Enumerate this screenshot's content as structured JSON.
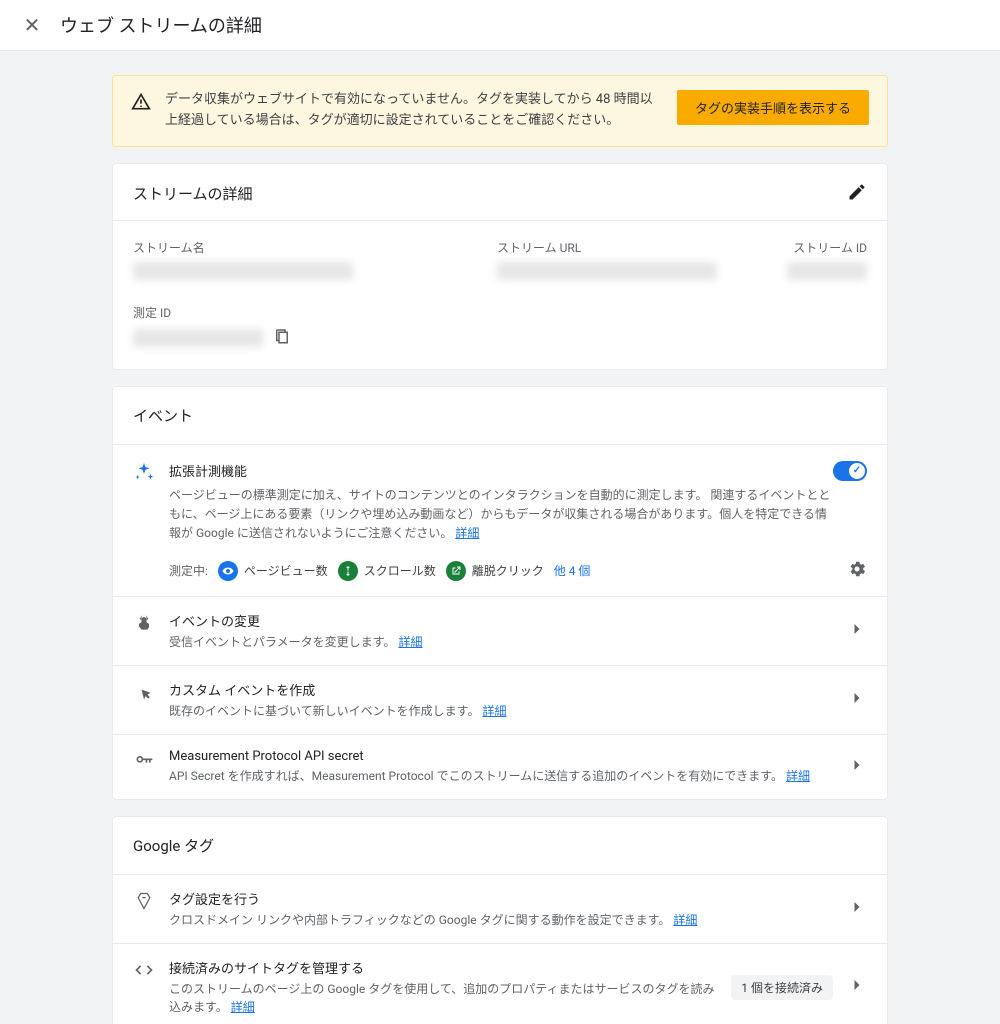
{
  "header": {
    "title": "ウェブ ストリームの詳細"
  },
  "alert": {
    "text": "データ収集がウェブサイトで有効になっていません。タグを実装してから 48 時間以上経過している場合は、タグが適切に設定されていることをご確認ください。",
    "button": "タグの実装手順を表示する"
  },
  "stream": {
    "title": "ストリームの詳細",
    "name_label": "ストリーム名",
    "url_label": "ストリーム URL",
    "id_label": "ストリーム ID",
    "measurement_id_label": "測定 ID"
  },
  "events": {
    "title": "イベント",
    "enhanced": {
      "title": "拡張計測機能",
      "desc": "ページビューの標準測定に加え、サイトのコンテンツとのインタラクションを自動的に測定します。\n関連するイベントとともに、ページ上にある要素（リンクや埋め込み動画など）からもデータが収集される場合があります。個人を特定できる情報が Google に送信されないようにご注意ください。",
      "details_link": "詳細",
      "measuring_label": "測定中:",
      "badge_pageview": "ページビュー数",
      "badge_scroll": "スクロール数",
      "badge_outbound": "離脱クリック",
      "more_count": "他 4 個"
    },
    "modify": {
      "title": "イベントの変更",
      "desc": "受信イベントとパラメータを変更します。",
      "link": "詳細"
    },
    "custom": {
      "title": "カスタム イベントを作成",
      "desc": "既存のイベントに基づいて新しいイベントを作成します。",
      "link": "詳細"
    },
    "mp_secret": {
      "title": "Measurement Protocol API secret",
      "desc": "API Secret を作成すれば、Measurement Protocol でこのストリームに送信する追加のイベントを有効にできます。",
      "link": "詳細"
    }
  },
  "google_tag": {
    "title": "Google タグ",
    "config": {
      "title": "タグ設定を行う",
      "desc": "クロスドメイン リンクや内部トラフィックなどの Google タグに関する動作を設定できます。",
      "link": "詳細"
    },
    "connected": {
      "title": "接続済みのサイトタグを管理する",
      "desc": "このストリームのページ上の Google タグを使用して、追加のプロパティまたはサービスのタグを読み込みます。",
      "link": "詳細",
      "badge": "1 個を接続済み"
    }
  }
}
